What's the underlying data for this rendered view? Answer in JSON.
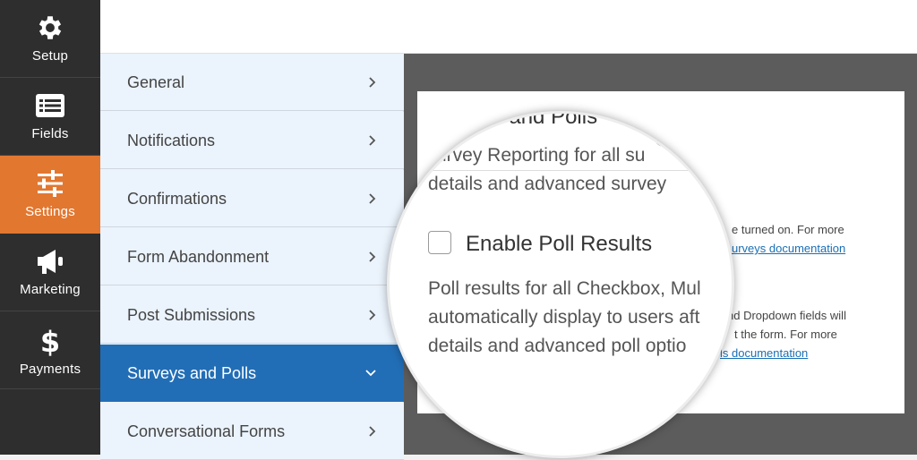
{
  "sidebar": {
    "items": [
      {
        "label": "Setup",
        "icon": "gear-icon"
      },
      {
        "label": "Fields",
        "icon": "fields-icon"
      },
      {
        "label": "Settings",
        "icon": "sliders-icon",
        "active": true
      },
      {
        "label": "Marketing",
        "icon": "megaphone-icon"
      },
      {
        "label": "Payments",
        "icon": "dollar-icon"
      }
    ]
  },
  "settings_panel": {
    "items": [
      {
        "label": "General"
      },
      {
        "label": "Notifications"
      },
      {
        "label": "Confirmations"
      },
      {
        "label": "Form Abandonment"
      },
      {
        "label": "Post Submissions"
      },
      {
        "label": "Surveys and Polls",
        "active": true
      },
      {
        "label": "Conversational Forms"
      }
    ]
  },
  "surveys": {
    "title_partial": "Surveys and Polls",
    "survey_reporting_line1": "urvey Reporting for all su",
    "survey_reporting_line2": "details and advanced survey",
    "enable_poll_label": "Enable Poll Results",
    "poll_desc_line1": "Poll results for all Checkbox, Mul",
    "poll_desc_line2": "automatically display to users aft",
    "poll_desc_line3": "details and advanced poll optio",
    "right_text_1": "e turned on. For more",
    "right_link_1": "urveys documentation",
    "right_text_2": "nd Dropdown fields will",
    "right_text_3": "t the form. For more",
    "right_link_2": "ls documentation"
  },
  "colors": {
    "accent_orange": "#e27730",
    "active_blue": "#226eb6",
    "rail_dark": "#2e2e2e"
  }
}
